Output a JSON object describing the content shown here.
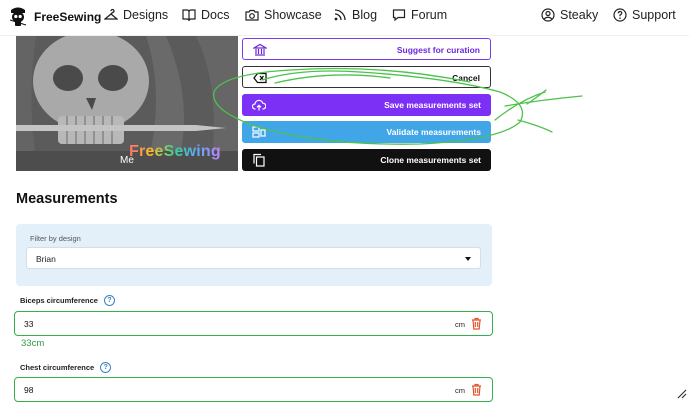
{
  "header": {
    "brand": "FreeSewing",
    "nav": [
      {
        "label": "Designs",
        "icon": "hanger-icon"
      },
      {
        "label": "Docs",
        "icon": "book-icon"
      },
      {
        "label": "Showcase",
        "icon": "camera-icon"
      },
      {
        "label": "Blog",
        "icon": "rss-icon"
      },
      {
        "label": "Forum",
        "icon": "chat-icon"
      }
    ],
    "user": {
      "label": "Steaky",
      "icon": "user-circle-icon"
    },
    "support": {
      "label": "Support",
      "icon": "question-circle-icon"
    }
  },
  "cover": {
    "caption": "Me",
    "watermark": "FreeSewing"
  },
  "actions": {
    "curate": "Suggest for curation",
    "cancel": "Cancel",
    "save": "Save measurements set",
    "validate": "Validate measurements",
    "clone": "Clone measurements set"
  },
  "measurements": {
    "title": "Measurements",
    "filter": {
      "label": "Filter by design",
      "value": "Brian"
    },
    "fields": [
      {
        "label": "Biceps circumference",
        "value": "33",
        "unit": "cm",
        "hint": "33cm"
      },
      {
        "label": "Chest circumference",
        "value": "98",
        "unit": "cm"
      }
    ]
  },
  "colors": {
    "accent": "#7c2ff5",
    "validate": "#40a6e8",
    "valid_border": "#34b04c",
    "annotation": "#4cc24c"
  }
}
